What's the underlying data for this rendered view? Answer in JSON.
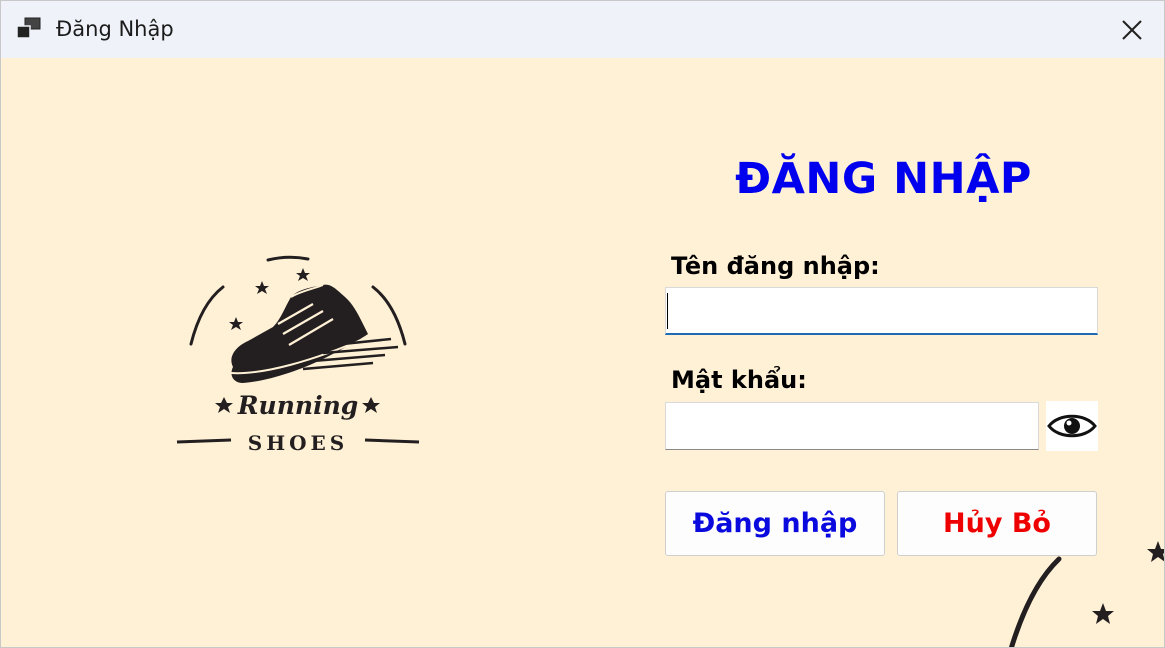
{
  "window": {
    "title": "Đăng Nhập",
    "close_icon": "close-icon",
    "app_icon": "app-window-icon"
  },
  "logo": {
    "brand_line1": "Running",
    "brand_line2": "SHOES",
    "icon": "running-shoe-logo"
  },
  "form": {
    "heading": "ĐĂNG NHẬP",
    "username_label": "Tên đăng nhập:",
    "username_value": "",
    "password_label": "Mật khẩu:",
    "password_value": "",
    "show_password_icon": "eye-icon",
    "login_button": "Đăng nhập",
    "cancel_button": "Hủy Bỏ"
  },
  "colors": {
    "background": "#fff1d6",
    "titlebar": "#eff3f9",
    "heading": "#0000ee",
    "login_text": "#0a0adf",
    "cancel_text": "#ee0000",
    "focus_border": "#1f6ab3"
  }
}
